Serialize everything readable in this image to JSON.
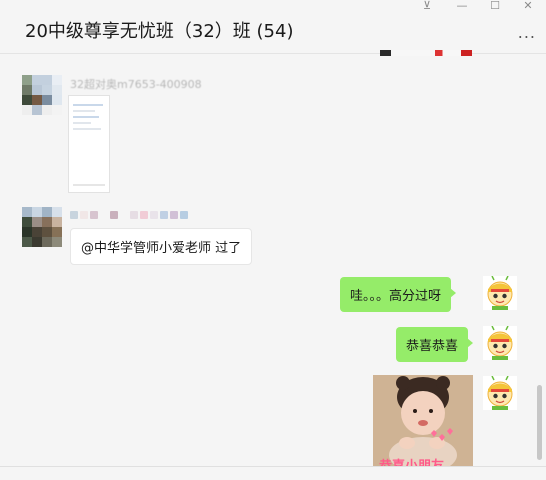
{
  "window": {
    "title": "20中级尊享无忧班（32）班 (54)",
    "controls": {
      "pin": "⊻",
      "minimize": "—",
      "maximize": "☐",
      "close": "✕"
    },
    "more_label": "..."
  },
  "messages": [
    {
      "sender_blurred": "32超对奥m7653-400908"
    },
    {
      "text": "@中华学管师小爱老师 过了"
    },
    {
      "text": "哇。。。高分过呀"
    },
    {
      "text": "恭喜恭喜"
    },
    {
      "sticker_caption": "恭喜小朋友"
    }
  ],
  "colors": {
    "self_bubble": "#95ec69",
    "other_bubble": "#ffffff",
    "background": "#f5f5f5"
  }
}
